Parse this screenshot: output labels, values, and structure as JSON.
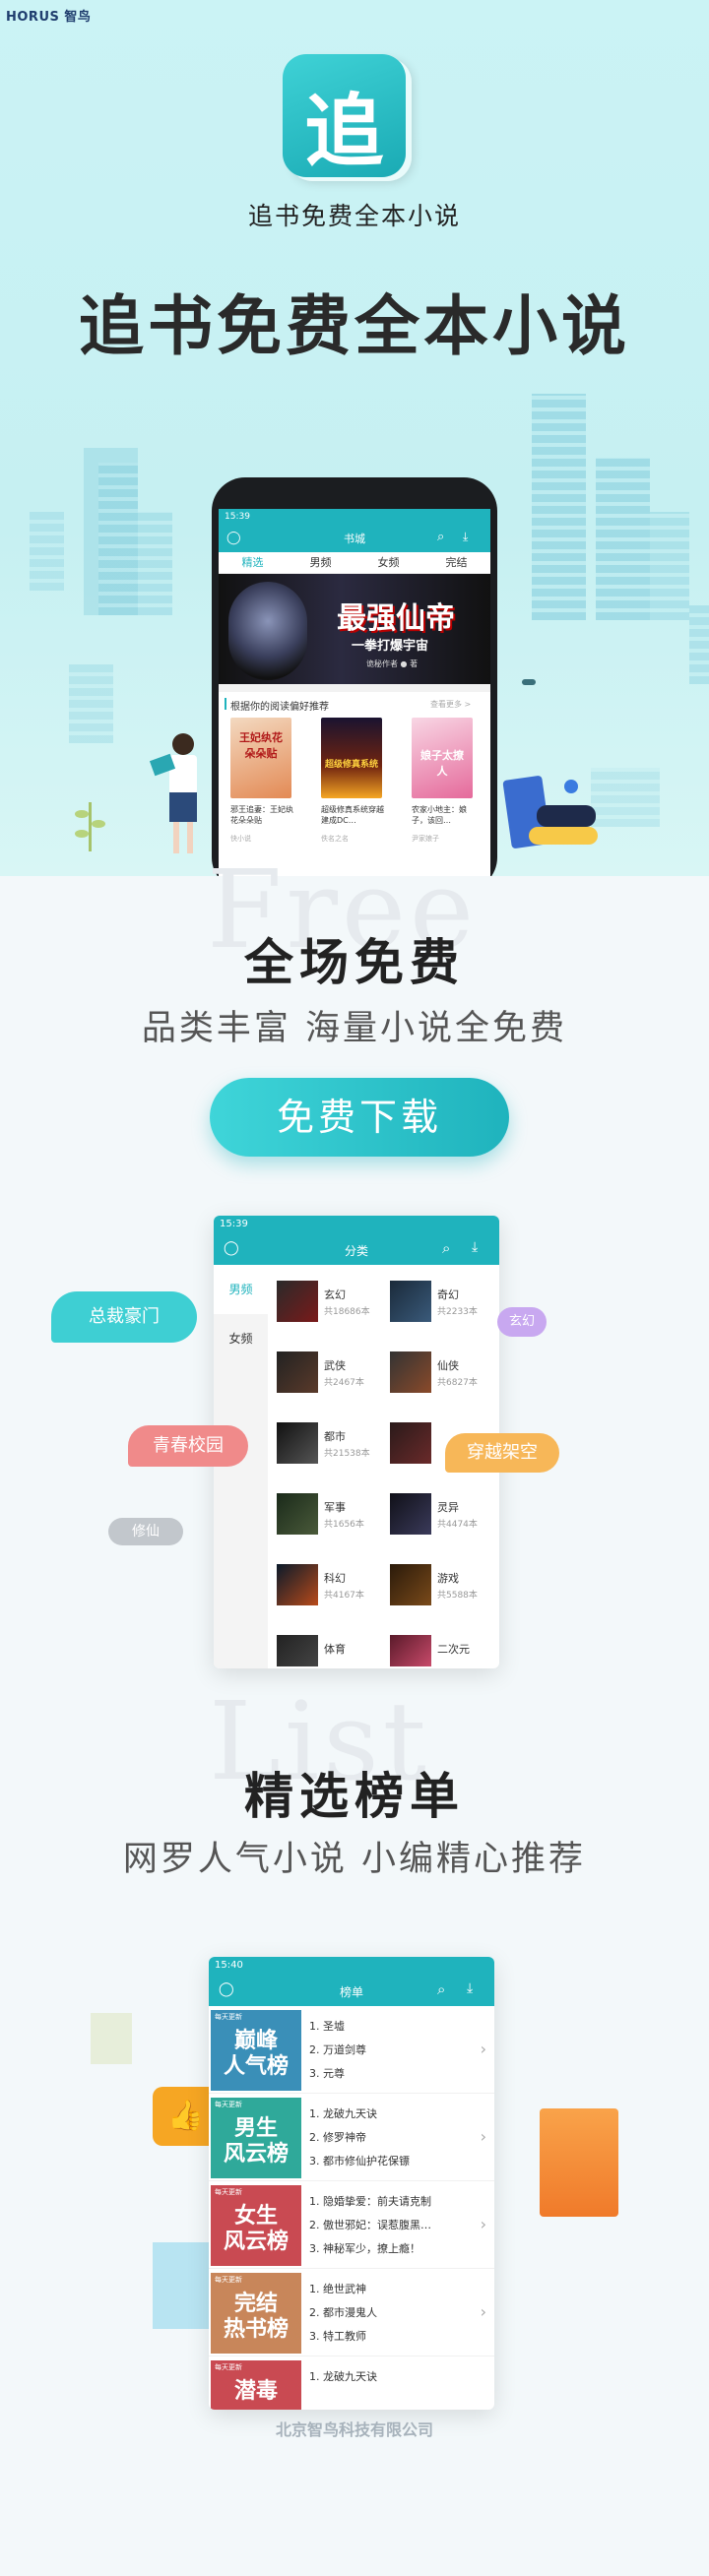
{
  "brand": "HORUS 智鸟",
  "app": {
    "logo_char": "追",
    "name": "追书免费全本小说",
    "headline": "追书免费全本小说"
  },
  "phone1": {
    "time": "15:39",
    "title": "书城",
    "tabs": [
      "精选",
      "男频",
      "女频",
      "完结"
    ],
    "banner_text": "最强仙帝",
    "banner_sub": "一拳打爆宇宙",
    "banner_author": "诡秘作者 ● 著",
    "rec_title": "根据你的阅读偏好推荐",
    "rec_more": "查看更多 >",
    "books": [
      {
        "title": "邪王追妻：王妃纨花朵朵贴",
        "author": "快小说",
        "cover": "王妃纨花朵朵贴"
      },
      {
        "title": "超级修真系统穿越建成DC…",
        "author": "佚名之名",
        "cover": "超级修真系统"
      },
      {
        "title": "农家小地主：娘子，该回…",
        "author": "尹家娘子",
        "cover": "娘子太撩人"
      }
    ]
  },
  "section_free": {
    "ghost": "Free",
    "title": "全场免费",
    "subtitle": "品类丰富 海量小说全免费",
    "button": "免费下载"
  },
  "phone2": {
    "time": "15:39",
    "title": "分类",
    "side": [
      "男频",
      "女频"
    ],
    "cats": [
      {
        "name": "玄幻",
        "count": "共18686本"
      },
      {
        "name": "奇幻",
        "count": "共2233本"
      },
      {
        "name": "武侠",
        "count": "共2467本"
      },
      {
        "name": "仙侠",
        "count": "共6827本"
      },
      {
        "name": "都市",
        "count": "共21538本"
      },
      {
        "name": "",
        "count": ""
      },
      {
        "name": "军事",
        "count": "共1656本"
      },
      {
        "name": "灵异",
        "count": "共4474本"
      },
      {
        "name": "科幻",
        "count": "共4167本"
      },
      {
        "name": "游戏",
        "count": "共5588本"
      },
      {
        "name": "体育",
        "count": ""
      },
      {
        "name": "二次元",
        "count": ""
      }
    ]
  },
  "tags": {
    "t1": "总裁豪门",
    "t2": "玄幻",
    "t3": "青春校园",
    "t4": "穿越架空",
    "t5": "修仙"
  },
  "section_list": {
    "ghost": "List",
    "title": "精选榜单",
    "subtitle": "网罗人气小说 小编精心推荐"
  },
  "phone3": {
    "time": "15:40",
    "title": "榜单",
    "ranks": [
      {
        "tag": "每天更新",
        "name1": "巅峰",
        "name2": "人气榜",
        "color": "#3a8fb8",
        "items": [
          "1. 圣墟",
          "2. 万道剑尊",
          "3. 元尊"
        ]
      },
      {
        "tag": "每天更新",
        "name1": "男生",
        "name2": "风云榜",
        "color": "#2fa99a",
        "items": [
          "1. 龙破九天诀",
          "2. 修罗神帝",
          "3. 都市修仙护花保镖"
        ]
      },
      {
        "tag": "每天更新",
        "name1": "女生",
        "name2": "风云榜",
        "color": "#c94a52",
        "items": [
          "1. 隐婚挚爱：前夫请克制",
          "2. 傲世邪妃：误惹腹黑…",
          "3. 神秘军少，撩上瘾！"
        ]
      },
      {
        "tag": "每天更新",
        "name1": "完结",
        "name2": "热书榜",
        "color": "#c8865a",
        "items": [
          "1. 绝世武神",
          "2. 都市漫鬼人",
          "3. 特工教师"
        ]
      },
      {
        "tag": "每天更新",
        "name1": "潜毒",
        "name2": "",
        "color": "#c94a52",
        "items": [
          "1. 龙破九天诀"
        ]
      }
    ]
  },
  "footer": "北京智鸟科技有限公司"
}
